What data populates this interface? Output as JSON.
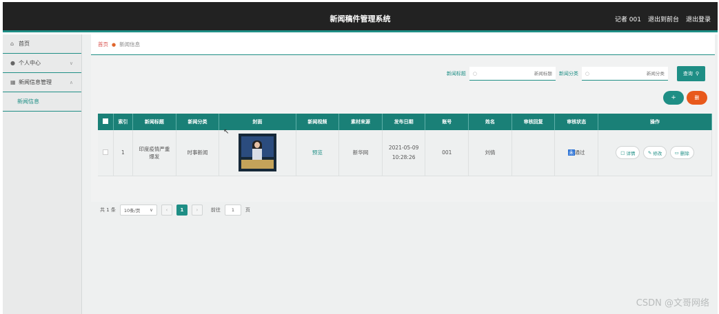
{
  "app": {
    "title": "新闻稿件管理系统"
  },
  "header": {
    "user": "记者 001",
    "back_front": "退出到前台",
    "logout": "退出登录"
  },
  "sidebar": {
    "items": [
      {
        "label": "首页",
        "icon": "home-icon"
      },
      {
        "label": "个人中心",
        "icon": "user-icon"
      },
      {
        "label": "新闻信息管理",
        "icon": "grid-icon"
      },
      {
        "label": "新闻信息",
        "icon": ""
      }
    ]
  },
  "breadcrumb": {
    "home": "首页",
    "current": "新闻信息"
  },
  "search": {
    "title_label": "新闻标题",
    "title_placeholder": "新闻标题",
    "category_label": "新闻分类",
    "category_placeholder": "新闻分类",
    "query_button": "查询"
  },
  "toolbar": {
    "add_label": "+",
    "delete_label": "删"
  },
  "table": {
    "columns": [
      "索引",
      "新闻标题",
      "新闻分类",
      "封面",
      "新闻视频",
      "素材来源",
      "发布日期",
      "账号",
      "姓名",
      "审核回复",
      "审核状态",
      "操作"
    ],
    "rows": [
      {
        "index": "1",
        "title": "印度疫情严重爆发",
        "category": "时事新闻",
        "video": "预览",
        "source": "新华网",
        "date": "2021-05-09 10:28:26",
        "account": "001",
        "name": "刘倩",
        "reply": "",
        "status_prefix": "未",
        "status_rest": "通过",
        "actions": {
          "detail": "详情",
          "edit": "修改",
          "delete": "删除"
        }
      }
    ]
  },
  "pager": {
    "total": "共 1 条",
    "page_size": "10条/页",
    "current_page": "1",
    "goto_label": "前往",
    "goto_value": "1",
    "page_unit": "页"
  },
  "watermark": "CSDN @文哥网络",
  "colors": {
    "accent": "#1e8e85",
    "danger": "#e8591b",
    "header": "#222222"
  }
}
